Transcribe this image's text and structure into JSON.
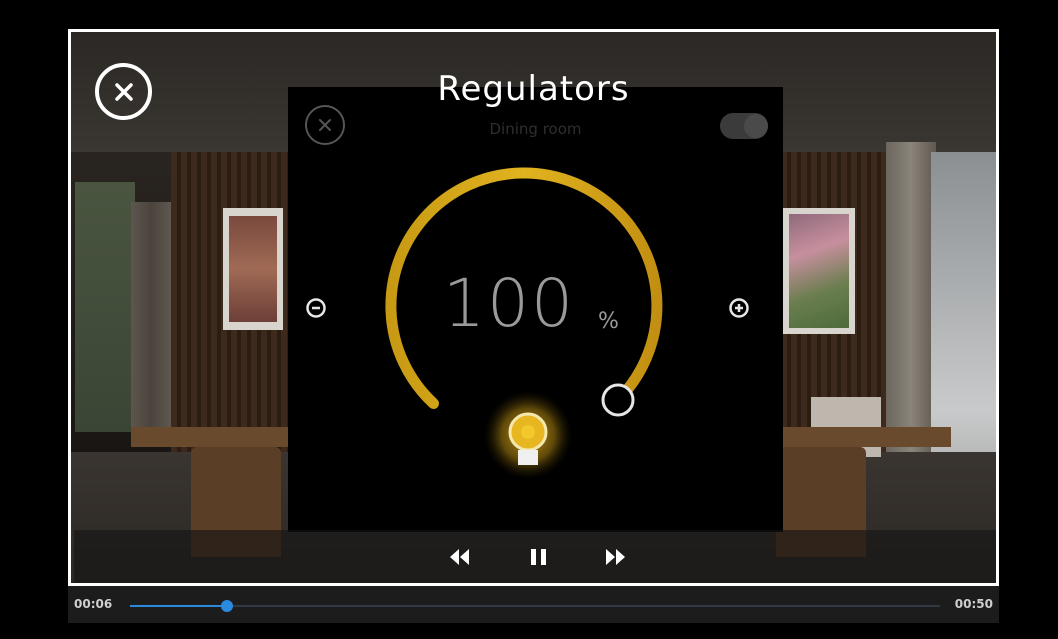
{
  "video": {
    "title": "Regulators"
  },
  "panel": {
    "subtitle": "Dining room",
    "value": "100",
    "unit": "%",
    "level_fraction": 1.0,
    "toggle_on": true,
    "accent_color": "#e5b21c"
  },
  "controls": {
    "rewind_icon": "rewind-icon",
    "pause_icon": "pause-icon",
    "forward_icon": "fast-forward-icon"
  },
  "seek": {
    "current_time": "00:06",
    "total_time": "00:50",
    "progress_fraction": 0.12,
    "accent_color": "#2a8ae0"
  }
}
